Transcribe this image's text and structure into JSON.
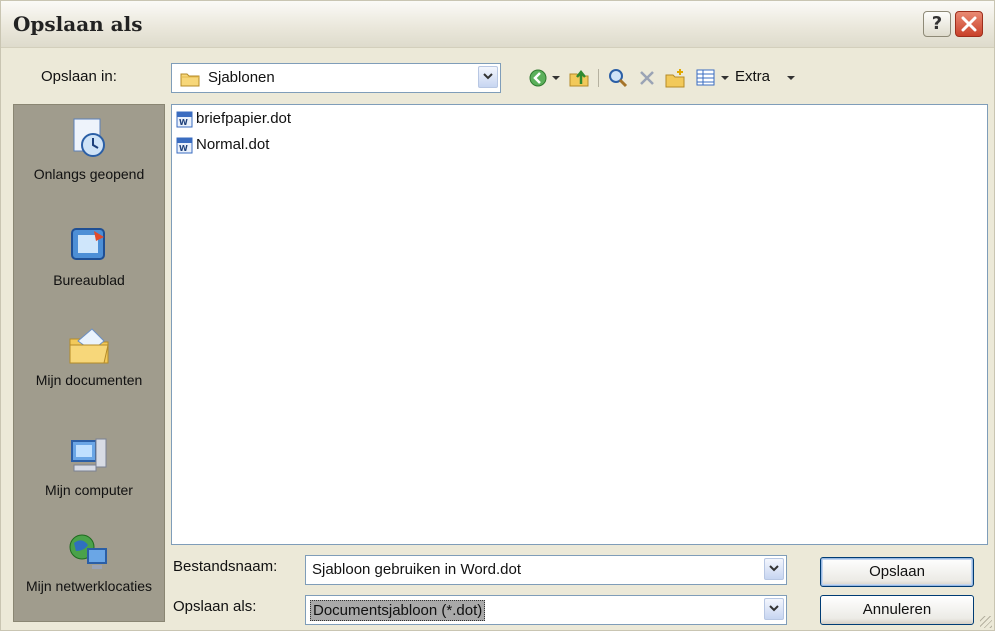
{
  "window": {
    "title": "Opslaan als"
  },
  "toolbar": {
    "save_in_label": "Opslaan in:",
    "location": "Sjablonen",
    "extra_label": "Extra",
    "icons": [
      "back-icon",
      "up-folder-icon",
      "search-web-icon",
      "delete-icon",
      "new-folder-icon",
      "views-icon"
    ]
  },
  "places": [
    {
      "label": "Onlangs geopend",
      "icon": "recent-documents-icon"
    },
    {
      "label": "Bureaublad",
      "icon": "desktop-icon"
    },
    {
      "label": "Mijn documenten",
      "icon": "my-documents-icon"
    },
    {
      "label": "Mijn computer",
      "icon": "my-computer-icon"
    },
    {
      "label": "Mijn netwerklocaties",
      "icon": "network-places-icon"
    }
  ],
  "files": [
    {
      "name": "briefpapier.dot",
      "icon": "word-template-icon"
    },
    {
      "name": "Normal.dot",
      "icon": "word-template-icon"
    }
  ],
  "filename": {
    "label": "Bestandsnaam:",
    "value": "Sjabloon gebruiken in Word.dot"
  },
  "filetype": {
    "label": "Opslaan als:",
    "value": "Documentsjabloon (*.dot)"
  },
  "buttons": {
    "save": "Opslaan",
    "cancel": "Annuleren"
  },
  "colors": {
    "dialog_bg": "#ECE9D8",
    "places_bg": "#A09C8D",
    "close_red": "#C9412A",
    "field_border": "#7F9DB9"
  }
}
